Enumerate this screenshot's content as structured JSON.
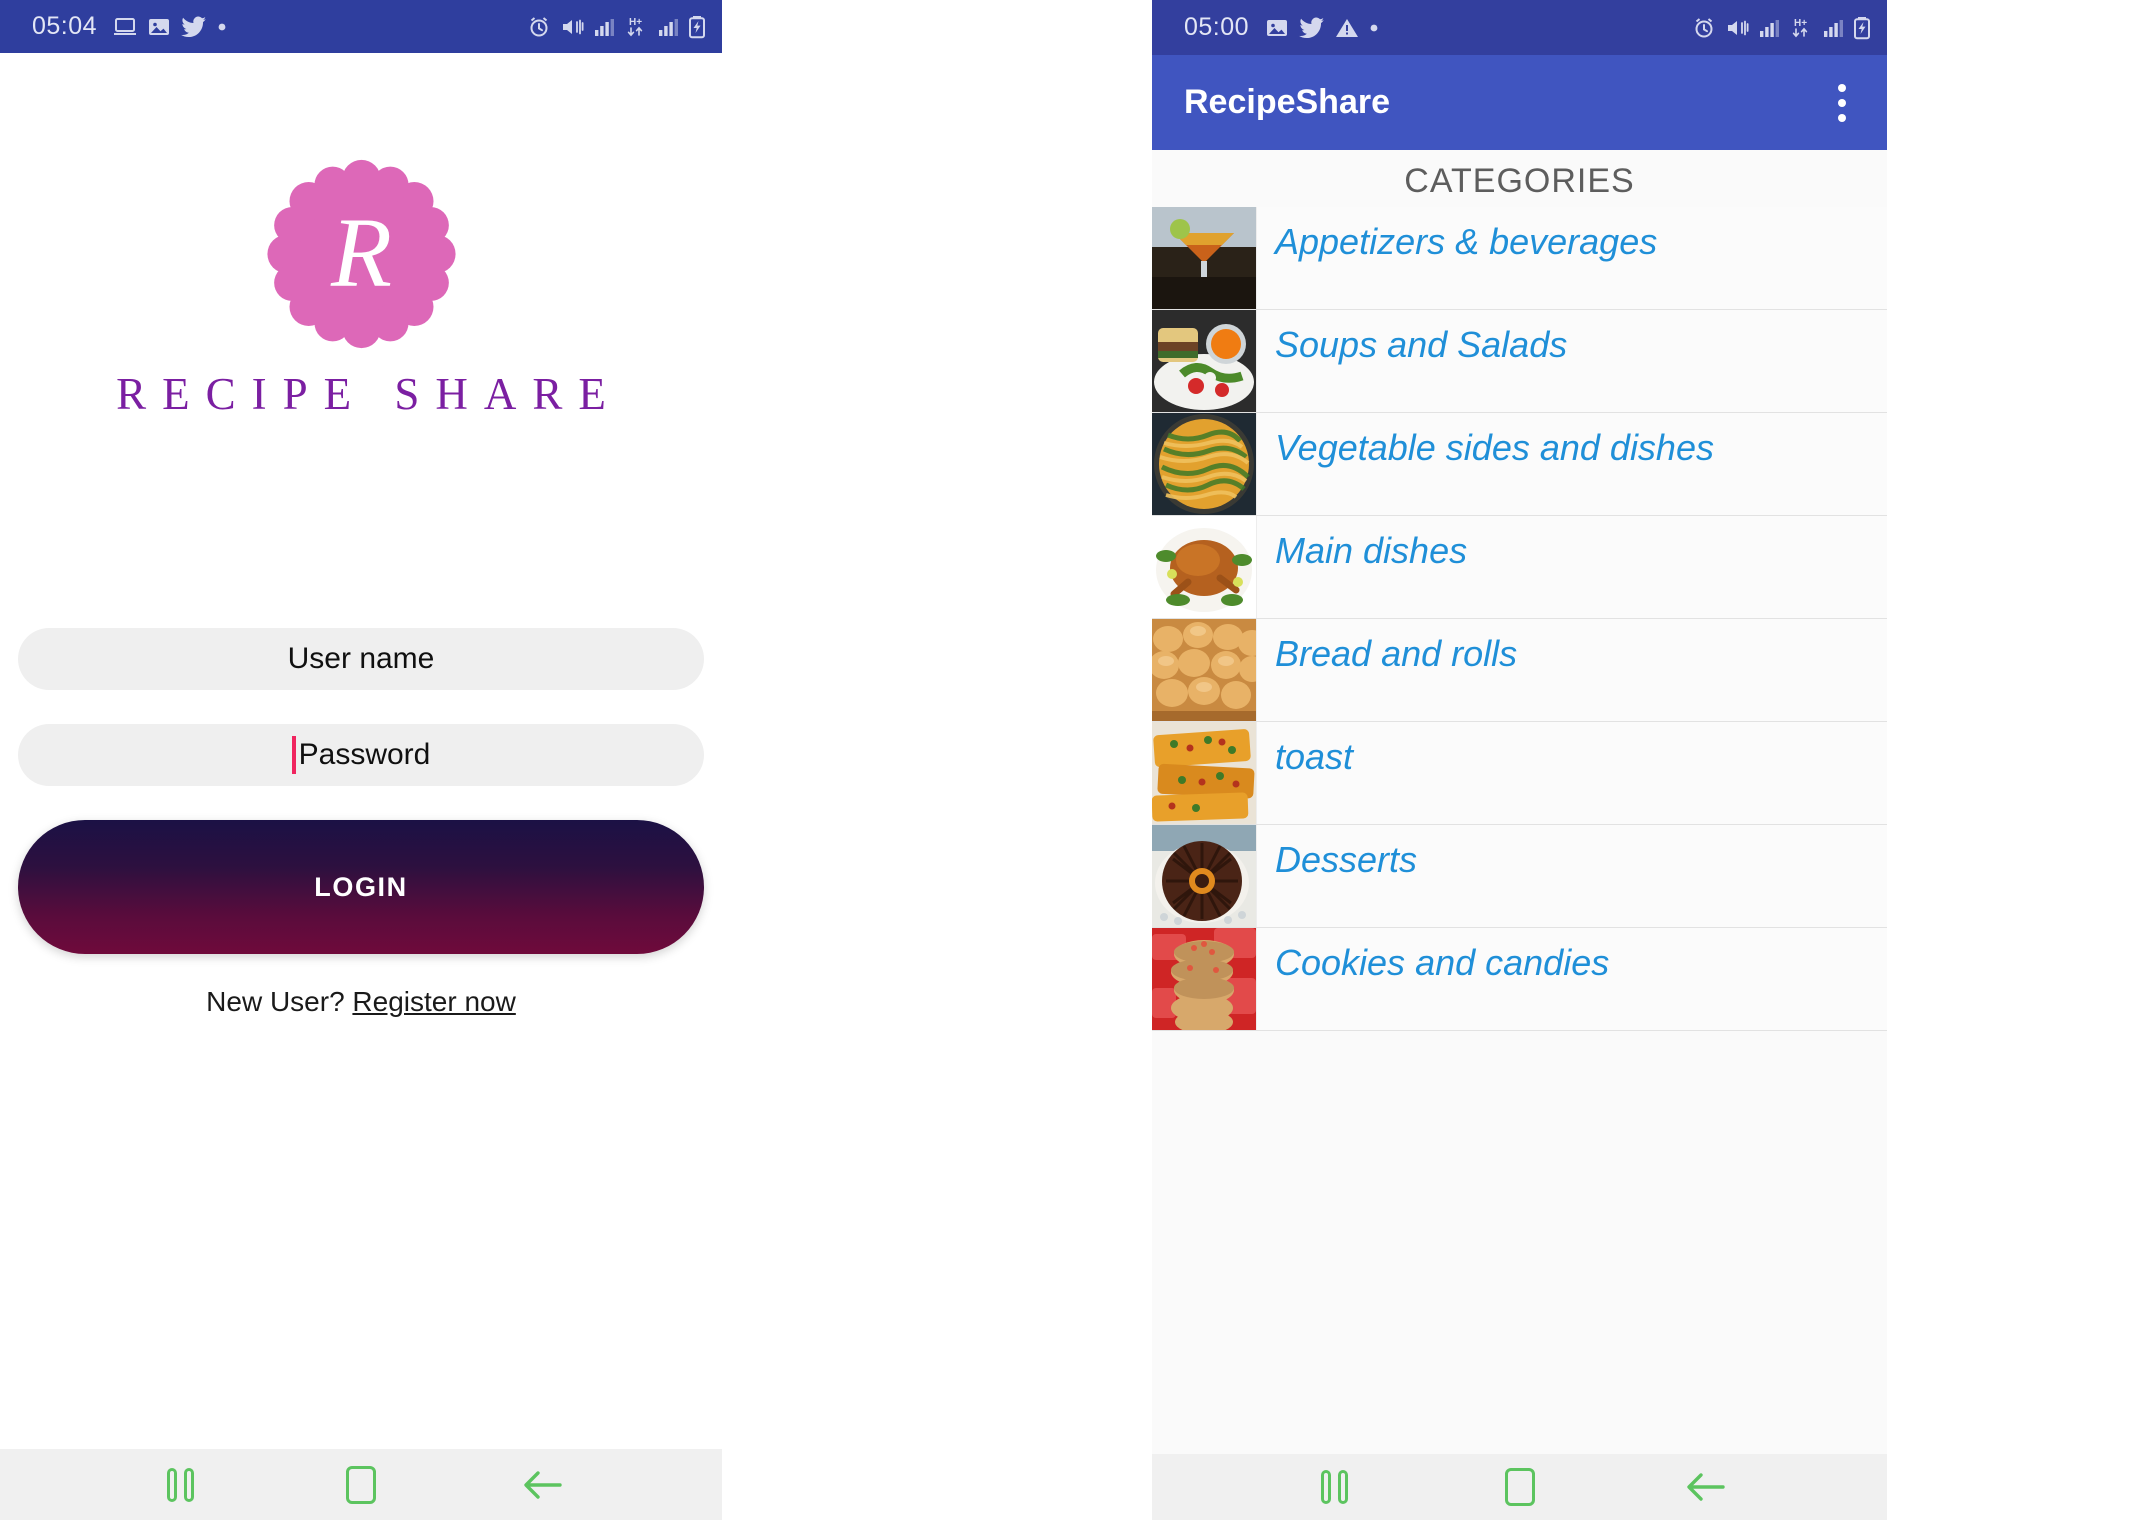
{
  "login_screen": {
    "status_bar": {
      "time": "05:04",
      "left_icons": [
        "laptop-icon",
        "image-icon",
        "twitter-icon",
        "dot-icon"
      ],
      "right_icons": [
        "alarm-icon",
        "mute-icon",
        "signal-icon",
        "hplus-data-icon",
        "signal-icon",
        "battery-charging-icon"
      ],
      "background_color": "#2f3e9e"
    },
    "logo": {
      "monogram": "R",
      "badge_color": "#dd68b8",
      "brand_name": "RECIPE SHARE",
      "brand_color": "#7b1fa2"
    },
    "form": {
      "username_value": "User name",
      "username_placeholder": "User name",
      "password_value": "Password",
      "password_placeholder": "Password",
      "cursor_color": "#f0255f",
      "login_button_label": "LOGIN",
      "login_gradient_top": "#1b1145",
      "login_gradient_bottom": "#6f0a3b"
    },
    "footer": {
      "new_user_text": "New User?",
      "register_link": "Register now"
    },
    "nav_bar": {
      "recents_label": "recents",
      "home_label": "home",
      "back_label": "back",
      "icon_color": "#5cc45f"
    }
  },
  "categories_screen": {
    "status_bar": {
      "time": "05:00",
      "left_icons": [
        "image-icon",
        "twitter-icon",
        "warning-icon",
        "dot-icon"
      ],
      "right_icons": [
        "alarm-icon",
        "mute-icon",
        "signal-icon",
        "hplus-data-icon",
        "signal-icon",
        "battery-charging-icon"
      ],
      "background_color": "#333f9e"
    },
    "app_bar": {
      "title": "RecipeShare",
      "overflow_menu": "more-options",
      "background_color": "#4055c0"
    },
    "list_header": "CATEGORIES",
    "link_color": "#1f8fd8",
    "items": [
      {
        "label": "Appetizers & beverages",
        "thumb": "cocktail-glass-photo"
      },
      {
        "label": "Soups and Salads",
        "thumb": "soup-and-salad-photo"
      },
      {
        "label": "Vegetable sides and dishes",
        "thumb": "green-bean-casserole-photo"
      },
      {
        "label": "Main dishes",
        "thumb": "roast-chicken-photo"
      },
      {
        "label": "Bread and rolls",
        "thumb": "dinner-rolls-photo"
      },
      {
        "label": "toast",
        "thumb": "toast-photo"
      },
      {
        "label": "Desserts",
        "thumb": "chocolate-bundt-cake-photo"
      },
      {
        "label": "Cookies and candies",
        "thumb": "stacked-cookies-photo"
      }
    ],
    "nav_bar": {
      "recents_label": "recents",
      "home_label": "home",
      "back_label": "back",
      "icon_color": "#5cc45f"
    }
  }
}
